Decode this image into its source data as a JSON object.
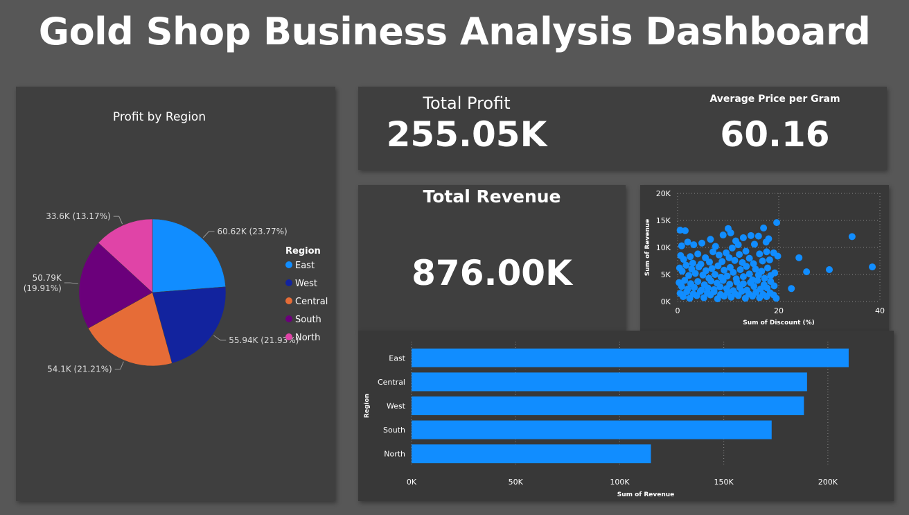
{
  "dashboard": {
    "title": "Gold Shop Business Analysis Dashboard"
  },
  "kpis": {
    "total_profit": {
      "label": "Total Profit",
      "value": "255.05K"
    },
    "avg_price": {
      "label": "Average Price per Gram",
      "value": "60.16"
    },
    "total_revenue": {
      "label": "Total Revenue",
      "value": "876.00K"
    }
  },
  "colors": {
    "background": "#575757",
    "panel": "#3f3f3f",
    "bar": "#118dff",
    "east": "#118dff",
    "west": "#12239e",
    "central": "#e66c37",
    "south": "#6b007b",
    "north": "#e044a7"
  },
  "chart_data": [
    {
      "type": "pie",
      "title": "Profit by Region",
      "legend_title": "Region",
      "legend_position": "right",
      "slices": [
        {
          "label": "East",
          "value": 60.62,
          "display": "60.62K (23.77%)",
          "color": "#118dff"
        },
        {
          "label": "West",
          "value": 55.94,
          "display": "55.94K (21.93%)",
          "color": "#12239e"
        },
        {
          "label": "Central",
          "value": 54.1,
          "display": "54.1K (21.21%)",
          "color": "#e66c37"
        },
        {
          "label": "South",
          "value": 50.79,
          "display": "50.79K (19.91%)",
          "display_lines": [
            "50.79K",
            "(19.91%)"
          ],
          "color": "#6b007b"
        },
        {
          "label": "North",
          "value": 33.6,
          "display": "33.6K (13.17%)",
          "color": "#e044a7"
        }
      ]
    },
    {
      "type": "scatter",
      "xlabel": "Sum of Discount (%)",
      "ylabel": "Sum of Revenue",
      "xlim": [
        0,
        40
      ],
      "ylim": [
        0,
        20000
      ],
      "xticks": [
        {
          "v": 0,
          "label": "0"
        },
        {
          "v": 20,
          "label": "20"
        },
        {
          "v": 40,
          "label": "40"
        }
      ],
      "yticks": [
        {
          "v": 0,
          "label": "0K"
        },
        {
          "v": 5000,
          "label": "5K"
        },
        {
          "v": 10000,
          "label": "10K"
        },
        {
          "v": 15000,
          "label": "15K"
        },
        {
          "v": 20000,
          "label": "20K"
        }
      ],
      "grid": true,
      "points": [
        [
          0.5,
          13200
        ],
        [
          1.5,
          13100
        ],
        [
          0.8,
          10300
        ],
        [
          2,
          11000
        ],
        [
          3.2,
          10500
        ],
        [
          4.8,
          10800
        ],
        [
          6.5,
          11500
        ],
        [
          7.5,
          10200
        ],
        [
          9,
          12300
        ],
        [
          10,
          13500
        ],
        [
          10.5,
          12700
        ],
        [
          11.5,
          11200
        ],
        [
          12,
          10500
        ],
        [
          13,
          11800
        ],
        [
          14.5,
          12200
        ],
        [
          15.2,
          10600
        ],
        [
          16,
          12100
        ],
        [
          17,
          13600
        ],
        [
          17.5,
          11000
        ],
        [
          18,
          11600
        ],
        [
          19.6,
          14600
        ],
        [
          0.6,
          8500
        ],
        [
          1.2,
          7800
        ],
        [
          2.5,
          8300
        ],
        [
          3,
          7100
        ],
        [
          4,
          8800
        ],
        [
          4.6,
          6900
        ],
        [
          5.5,
          8100
        ],
        [
          6.3,
          7300
        ],
        [
          7,
          9200
        ],
        [
          8.2,
          8600
        ],
        [
          8.8,
          7400
        ],
        [
          9.6,
          9000
        ],
        [
          10.2,
          8100
        ],
        [
          10.8,
          9900
        ],
        [
          11.3,
          7600
        ],
        [
          12.2,
          8700
        ],
        [
          12.8,
          7200
        ],
        [
          13.5,
          9300
        ],
        [
          14.2,
          8000
        ],
        [
          15,
          7000
        ],
        [
          16.2,
          8800
        ],
        [
          16.8,
          7500
        ],
        [
          17.6,
          9200
        ],
        [
          18.2,
          7700
        ],
        [
          19,
          9000
        ],
        [
          19.8,
          8400
        ],
        [
          0.4,
          6200
        ],
        [
          0.9,
          5600
        ],
        [
          1.7,
          6700
        ],
        [
          2.2,
          4800
        ],
        [
          2.8,
          6000
        ],
        [
          3.5,
          5200
        ],
        [
          4.2,
          6400
        ],
        [
          5,
          4900
        ],
        [
          5.6,
          5700
        ],
        [
          6.2,
          4300
        ],
        [
          6.8,
          6100
        ],
        [
          7.4,
          5000
        ],
        [
          8,
          6600
        ],
        [
          8.6,
          4500
        ],
        [
          9.2,
          5800
        ],
        [
          9.8,
          4700
        ],
        [
          10.4,
          6300
        ],
        [
          11,
          5400
        ],
        [
          11.6,
          4200
        ],
        [
          12.4,
          5900
        ],
        [
          13,
          4600
        ],
        [
          13.6,
          6500
        ],
        [
          14.2,
          5100
        ],
        [
          14.8,
          4000
        ],
        [
          15.4,
          6000
        ],
        [
          16,
          4900
        ],
        [
          16.6,
          5600
        ],
        [
          17.2,
          4300
        ],
        [
          17.8,
          6200
        ],
        [
          18.4,
          4800
        ],
        [
          19.2,
          5300
        ],
        [
          0.3,
          3500
        ],
        [
          0.8,
          2800
        ],
        [
          1.4,
          3900
        ],
        [
          2,
          2300
        ],
        [
          2.6,
          3300
        ],
        [
          3.3,
          2600
        ],
        [
          4,
          3700
        ],
        [
          4.7,
          2100
        ],
        [
          5.3,
          3100
        ],
        [
          6,
          2500
        ],
        [
          6.6,
          3800
        ],
        [
          7.2,
          2200
        ],
        [
          7.8,
          3400
        ],
        [
          8.4,
          2700
        ],
        [
          9,
          3900
        ],
        [
          9.7,
          2400
        ],
        [
          10.3,
          3200
        ],
        [
          11,
          2000
        ],
        [
          11.7,
          3600
        ],
        [
          12.3,
          2600
        ],
        [
          13,
          3300
        ],
        [
          13.7,
          2100
        ],
        [
          14.4,
          3500
        ],
        [
          15.1,
          2800
        ],
        [
          15.8,
          3900
        ],
        [
          16.4,
          2300
        ],
        [
          17.1,
          3100
        ],
        [
          17.7,
          2500
        ],
        [
          18.4,
          3700
        ],
        [
          19.1,
          2900
        ],
        [
          0.5,
          1500
        ],
        [
          1.1,
          900
        ],
        [
          1.8,
          1800
        ],
        [
          2.4,
          600
        ],
        [
          3.1,
          1400
        ],
        [
          3.8,
          1100
        ],
        [
          4.5,
          1900
        ],
        [
          5.2,
          700
        ],
        [
          5.9,
          1600
        ],
        [
          6.5,
          1200
        ],
        [
          7.2,
          1800
        ],
        [
          7.9,
          500
        ],
        [
          8.5,
          1300
        ],
        [
          9.2,
          1000
        ],
        [
          9.9,
          1700
        ],
        [
          10.6,
          800
        ],
        [
          11.3,
          1500
        ],
        [
          12,
          1100
        ],
        [
          12.7,
          1900
        ],
        [
          13.4,
          600
        ],
        [
          14.1,
          1400
        ],
        [
          14.8,
          1000
        ],
        [
          15.5,
          1700
        ],
        [
          16.2,
          700
        ],
        [
          16.9,
          1300
        ],
        [
          17.6,
          900
        ],
        [
          18.3,
          1600
        ],
        [
          19,
          1200
        ],
        [
          19.5,
          600
        ],
        [
          22.5,
          2400
        ],
        [
          24,
          8100
        ],
        [
          25.5,
          5500
        ],
        [
          30,
          5900
        ],
        [
          34.5,
          12000
        ],
        [
          38.5,
          6400
        ]
      ]
    },
    {
      "type": "bar",
      "orientation": "horizontal",
      "xlabel": "Sum of Revenue",
      "ylabel": "Region",
      "xlim": [
        0,
        225000
      ],
      "xticks": [
        {
          "v": 0,
          "label": "0K"
        },
        {
          "v": 50000,
          "label": "50K"
        },
        {
          "v": 100000,
          "label": "100K"
        },
        {
          "v": 150000,
          "label": "150K"
        },
        {
          "v": 200000,
          "label": "200K"
        }
      ],
      "grid": true,
      "categories": [
        "East",
        "Central",
        "West",
        "South",
        "North"
      ],
      "values": [
        210000,
        190000,
        188500,
        173000,
        115000
      ]
    }
  ]
}
